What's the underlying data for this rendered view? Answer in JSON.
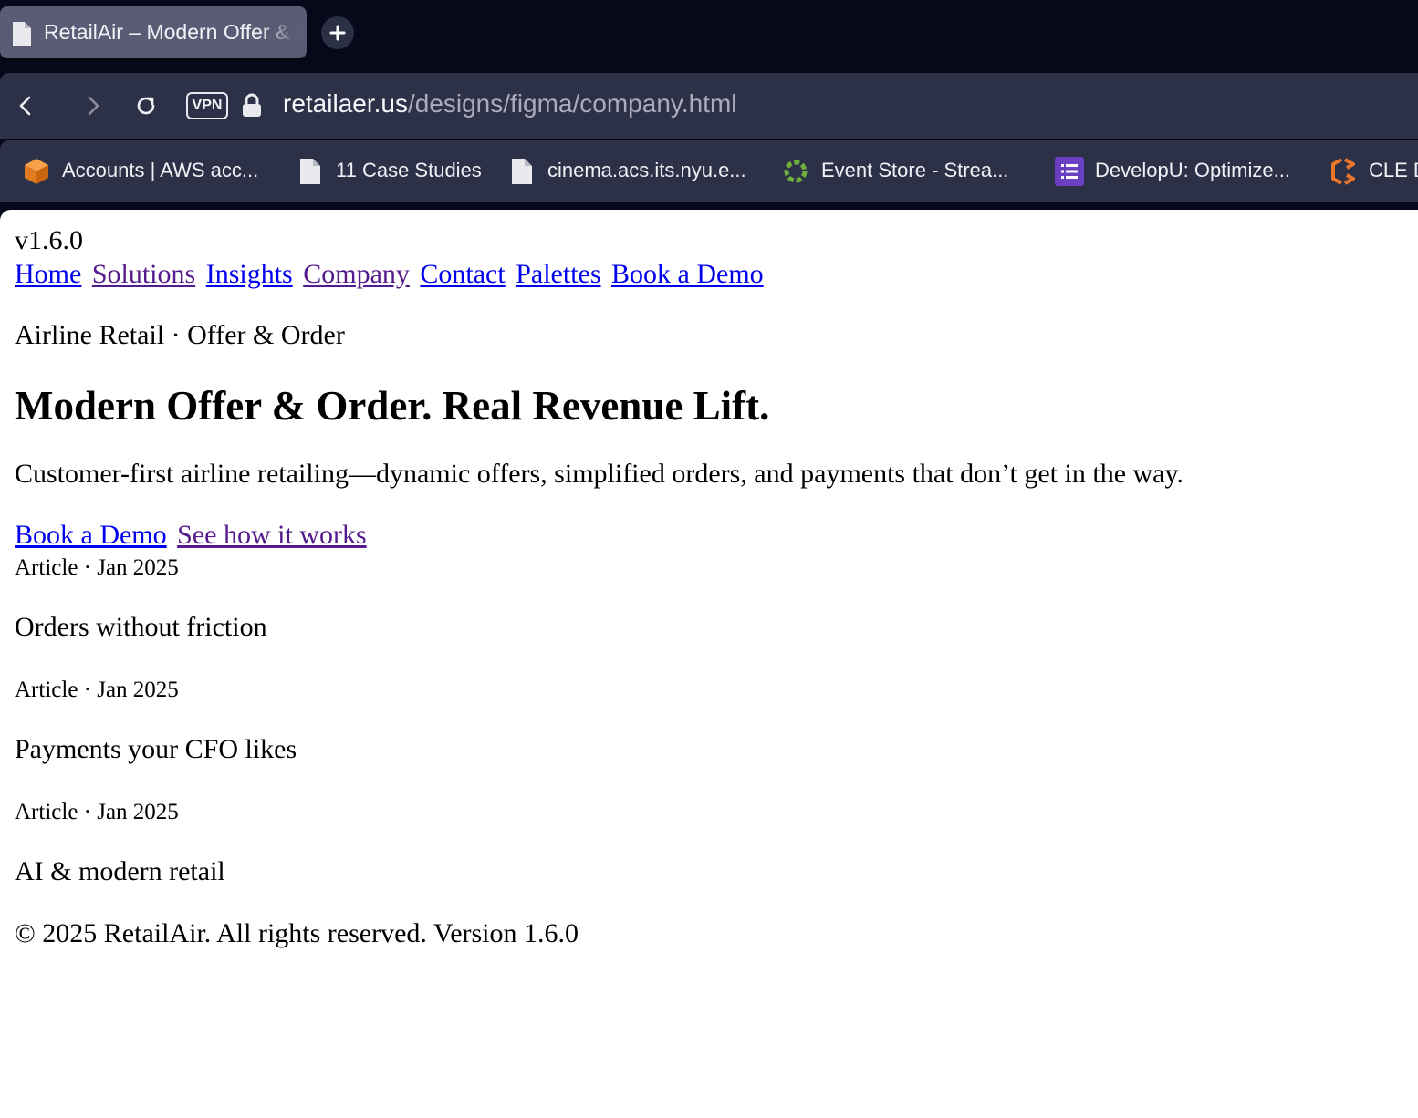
{
  "browser": {
    "tab": {
      "title": "RetailAir – Modern Offer & Order",
      "icon": "document-icon"
    },
    "new_tab_icon": "plus-icon",
    "toolbar": {
      "back_icon": "chevron-left-icon",
      "forward_icon": "chevron-right-icon",
      "reload_icon": "reload-icon",
      "vpn_label": "VPN",
      "lock_icon": "lock-icon",
      "url_host": "retailaer.us",
      "url_path": "/designs/figma/company.html"
    },
    "bookmarks": [
      {
        "label": "Accounts | AWS acc...",
        "icon": "aws-cube-icon"
      },
      {
        "label": "11 Case Studies",
        "icon": "document-icon"
      },
      {
        "label": "cinema.acs.its.nyu.e...",
        "icon": "document-icon"
      },
      {
        "label": "Event Store - Strea...",
        "icon": "eventstore-ring-icon"
      },
      {
        "label": "DevelopU: Optimize...",
        "icon": "list-icon"
      },
      {
        "label": "CLE D",
        "icon": "cle-logo-icon"
      }
    ],
    "colors": {
      "chrome_bg": "#06091a",
      "toolbar_bg": "#2d3148",
      "tab_active": "#5a5c75",
      "link": "#0000ee",
      "visited_link": "#551a8b"
    }
  },
  "page": {
    "version": "v1.6.0",
    "nav": [
      {
        "label": "Home",
        "visited": false
      },
      {
        "label": "Solutions",
        "visited": true
      },
      {
        "label": "Insights",
        "visited": false
      },
      {
        "label": "Company",
        "visited": true
      },
      {
        "label": "Contact",
        "visited": false
      },
      {
        "label": "Palettes",
        "visited": false
      },
      {
        "label": "Book a Demo",
        "visited": false
      }
    ],
    "eyebrow": "Airline Retail · Offer & Order",
    "hero_title": "Modern Offer & Order. Real Revenue Lift.",
    "hero_subtitle": "Customer-first airline retailing—dynamic offers, simplified orders, and payments that don’t get in the way.",
    "cta_primary": "Book a Demo",
    "cta_secondary": "See how it works",
    "articles": [
      {
        "meta": "Article · Jan 2025",
        "title": "Orders without friction"
      },
      {
        "meta": "Article · Jan 2025",
        "title": "Payments your CFO likes"
      },
      {
        "meta": "Article · Jan 2025",
        "title": "AI & modern retail"
      }
    ],
    "footer": "© 2025 RetailAir. All rights reserved. Version 1.6.0"
  }
}
